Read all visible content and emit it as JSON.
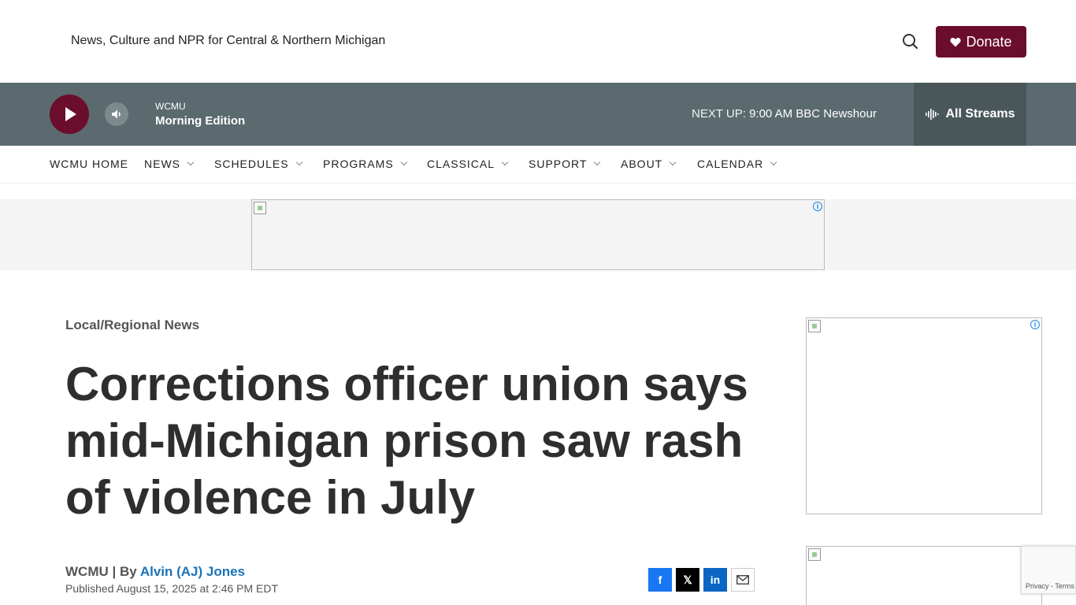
{
  "header": {
    "tagline": "News, Culture and NPR for Central & Northern Michigan",
    "donate_label": "Donate"
  },
  "player": {
    "station": "WCMU",
    "show": "Morning Edition",
    "next_up_label": "NEXT UP:",
    "next_up_value": "9:00 AM BBC Newshour",
    "streams_label": "All Streams"
  },
  "nav": {
    "items": [
      {
        "label": "WCMU HOME",
        "dropdown": false
      },
      {
        "label": "NEWS",
        "dropdown": true
      },
      {
        "label": "SCHEDULES",
        "dropdown": true
      },
      {
        "label": "PROGRAMS",
        "dropdown": true
      },
      {
        "label": "CLASSICAL",
        "dropdown": true
      },
      {
        "label": "SUPPORT",
        "dropdown": true
      },
      {
        "label": "ABOUT",
        "dropdown": true
      },
      {
        "label": "CALENDAR",
        "dropdown": true
      }
    ]
  },
  "article": {
    "category": "Local/Regional News",
    "headline": "Corrections officer union says mid-Michigan prison saw rash of violence in July",
    "source": "WCMU",
    "by_label": "By",
    "author": "Alvin (AJ) Jones",
    "published": "Published August 15, 2025 at 2:46 PM EDT"
  },
  "share": {
    "facebook": "f",
    "x": "𝕏",
    "linkedin": "in"
  },
  "recaptcha": {
    "privacy": "Privacy",
    "terms": "Terms"
  },
  "colors": {
    "brand": "#6b0d2c",
    "player_bg": "#5a6a6e",
    "link": "#1a73b8"
  }
}
